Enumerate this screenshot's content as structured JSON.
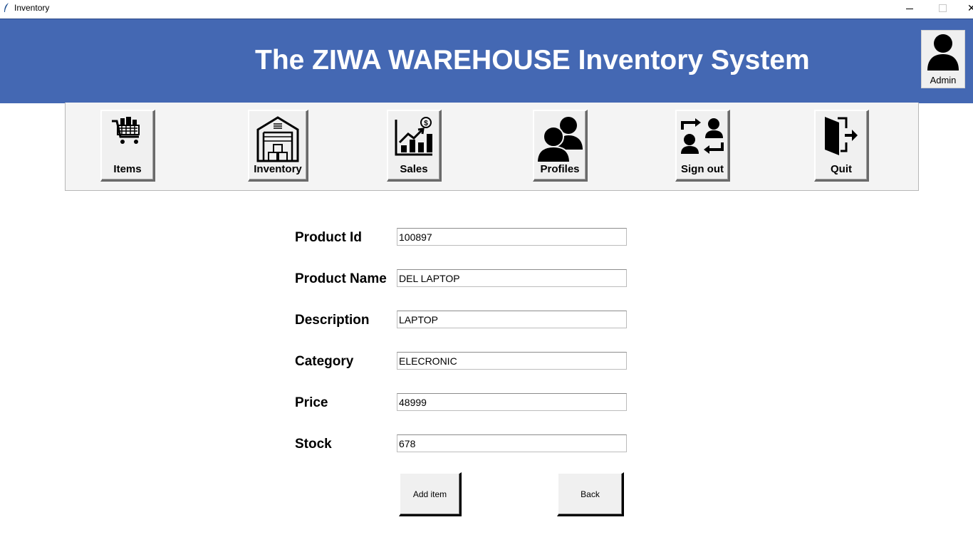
{
  "window": {
    "title": "Inventory",
    "minimize_glyph": "",
    "close_glyph": "✕"
  },
  "banner": {
    "title": "The ZIWA WAREHOUSE Inventory System",
    "background": "#4468b3",
    "avatar_label": "Admin"
  },
  "toolbar": {
    "items": [
      {
        "label": "Items",
        "icon": "shopping-cart-icon"
      },
      {
        "label": "Inventory",
        "icon": "warehouse-icon"
      },
      {
        "label": "Sales",
        "icon": "sales-chart-icon"
      },
      {
        "label": "Profiles",
        "icon": "users-icon"
      },
      {
        "label": "Sign out",
        "icon": "switch-user-icon"
      },
      {
        "label": "Quit",
        "icon": "exit-door-icon"
      }
    ]
  },
  "form": {
    "fields": [
      {
        "label": "Product Id",
        "value": "100897"
      },
      {
        "label": "Product Name",
        "value": "DEL LAPTOP"
      },
      {
        "label": "Description",
        "value": "LAPTOP"
      },
      {
        "label": "Category",
        "value": "ELECRONIC"
      },
      {
        "label": "Price",
        "value": "48999"
      },
      {
        "label": "Stock",
        "value": "678"
      }
    ],
    "add_label": "Add item",
    "back_label": "Back"
  }
}
